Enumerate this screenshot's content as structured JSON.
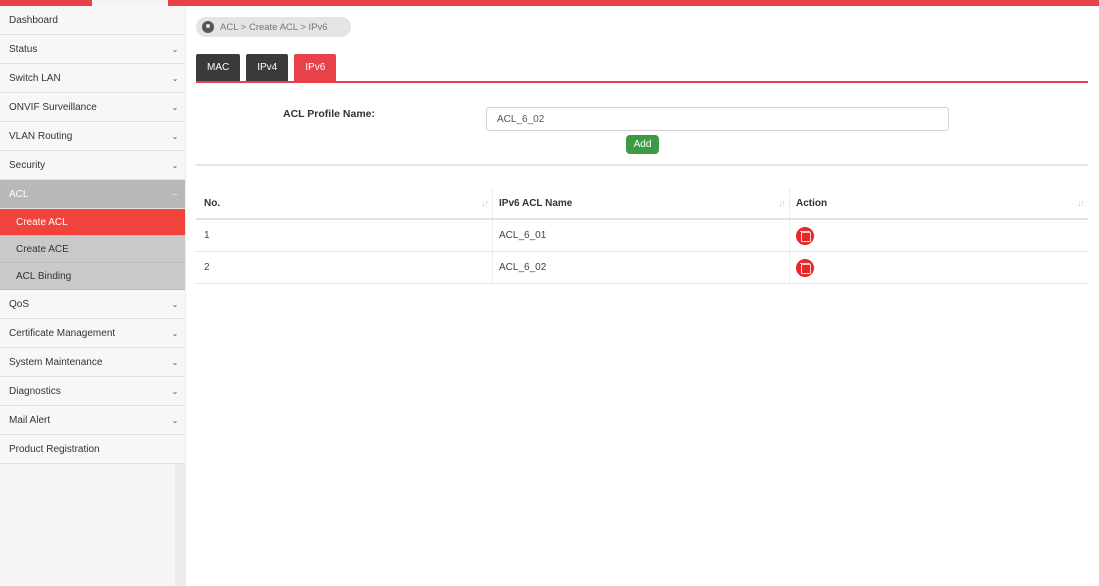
{
  "sidebar": {
    "items": [
      {
        "label": "Dashboard"
      },
      {
        "label": "Status"
      },
      {
        "label": "Switch LAN"
      },
      {
        "label": "ONVIF Surveillance"
      },
      {
        "label": "VLAN Routing"
      },
      {
        "label": "Security"
      },
      {
        "label": "ACL"
      },
      {
        "label": "QoS"
      },
      {
        "label": "Certificate Management"
      },
      {
        "label": "System Maintenance"
      },
      {
        "label": "Diagnostics"
      },
      {
        "label": "Mail Alert"
      },
      {
        "label": "Product Registration"
      }
    ],
    "acl_subitems": [
      {
        "label": "Create ACL"
      },
      {
        "label": "Create ACE"
      },
      {
        "label": "ACL Binding"
      }
    ],
    "chevron_down": "⌄",
    "chevron_open": "–"
  },
  "breadcrumb": {
    "text": "ACL > Create ACL > IPv6"
  },
  "tabs": [
    {
      "label": "MAC"
    },
    {
      "label": "IPv4"
    },
    {
      "label": "IPv6"
    }
  ],
  "form": {
    "label": "ACL Profile Name:",
    "value": "ACL_6_02",
    "add_label": "Add"
  },
  "table": {
    "headers": [
      "No.",
      "IPv6 ACL Name",
      "Action"
    ],
    "sort_icon": "↓↑",
    "rows": [
      {
        "no": "1",
        "name": "ACL_6_01"
      },
      {
        "no": "2",
        "name": "ACL_6_02"
      }
    ]
  },
  "colors": {
    "accent": "#e8414a",
    "active_sidebar": "#f1433b",
    "tab_dark": "#3a3a3a",
    "add_button": "#3c9a43",
    "delete_button": "#e82828"
  }
}
